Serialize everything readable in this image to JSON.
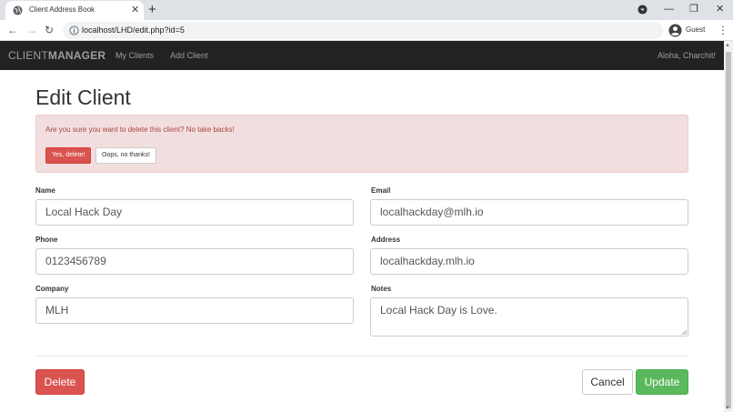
{
  "browser": {
    "tab_title": "Client Address Book",
    "tab_close": "✕",
    "new_tab": "+",
    "url": "localhost/LHD/edit.php?id=5",
    "profile_label": "Guest",
    "back": "←",
    "forward": "→",
    "reload": "↻",
    "menu": "⋮",
    "minimize": "—",
    "restore": "❐",
    "close": "✕"
  },
  "navbar": {
    "brand_light": "CLIENT",
    "brand_bold": "MANAGER",
    "links": [
      "My Clients",
      "Add Client"
    ],
    "greeting": "Aloha, Charchit!"
  },
  "page": {
    "title": "Edit Client"
  },
  "alert": {
    "message": "Are you sure you want to delete this client? No take backs!",
    "confirm_label": "Yes, delete!",
    "dismiss_label": "Oops, no thanks!"
  },
  "form": {
    "name_label": "Name",
    "name_value": "Local Hack Day",
    "email_label": "Email",
    "email_value": "localhackday@mlh.io",
    "phone_label": "Phone",
    "phone_value": "0123456789",
    "address_label": "Address",
    "address_value": "localhackday.mlh.io",
    "company_label": "Company",
    "company_value": "MLH",
    "notes_label": "Notes",
    "notes_value": "Local Hack Day is Love."
  },
  "actions": {
    "delete_label": "Delete",
    "cancel_label": "Cancel",
    "update_label": "Update"
  },
  "colors": {
    "navbar_bg": "#222222",
    "danger": "#d9534f",
    "success": "#5cb85c",
    "alert_bg": "#f2dede",
    "alert_text": "#a94442"
  },
  "icons": {
    "tab_favicon": "globe-icon",
    "info": "info-icon",
    "profile": "person-icon",
    "download_dropdown": "chevron-down-circle-icon"
  }
}
